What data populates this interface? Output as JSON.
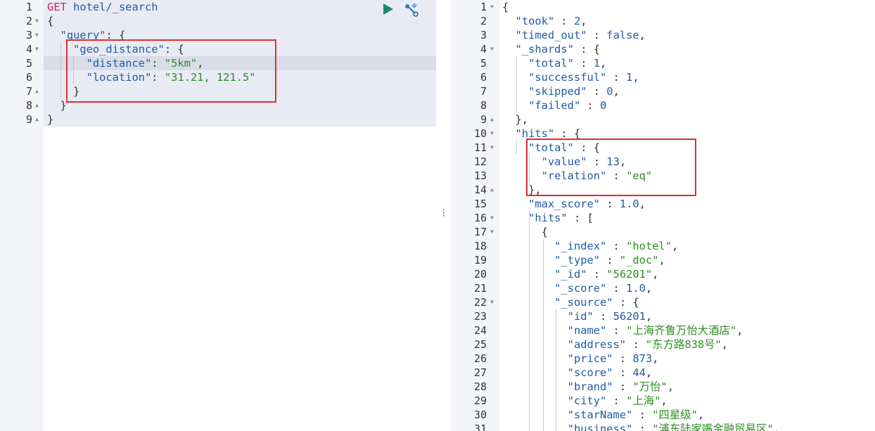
{
  "request": {
    "method": "GET",
    "path": "hotel/_search",
    "lines": [
      "1",
      "2",
      "3",
      "4",
      "5",
      "6",
      "7",
      "8",
      "9"
    ],
    "code": {
      "l2": "{",
      "l3_key": "\"query\"",
      "l3_rest": ": {",
      "l4_key": "\"geo_distance\"",
      "l4_rest": ": {",
      "l5_key": "\"distance\"",
      "l5_val": "\"5km\"",
      "l6_key": "\"location\"",
      "l6_val": "\"31.21, 121.5\"",
      "l7": "}",
      "l8": "}",
      "l9": "}"
    },
    "run_icon": "play-icon",
    "settings_icon": "wrench-icon"
  },
  "response": {
    "lines": [
      "1",
      "2",
      "3",
      "4",
      "5",
      "6",
      "7",
      "8",
      "9",
      "10",
      "11",
      "12",
      "13",
      "14",
      "15",
      "16",
      "17",
      "18",
      "19",
      "20",
      "21",
      "22",
      "23",
      "24",
      "25",
      "26",
      "27",
      "28",
      "29",
      "30",
      "31"
    ],
    "took": "2",
    "timed_out": "false",
    "shards_total": "1",
    "shards_successful": "1",
    "shards_skipped": "0",
    "shards_failed": "0",
    "hits_total_value": "13",
    "hits_total_relation": "\"eq\"",
    "max_score": "1.0",
    "index": "\"hotel\"",
    "type": "\"_doc\"",
    "id": "\"56201\"",
    "score": "1.0",
    "source_id": "56201",
    "name": "\"上海齐鲁万怡大酒店\"",
    "address": "\"东方路838号\"",
    "price": "873",
    "source_score": "44",
    "brand": "\"万怡\"",
    "city": "\"上海\"",
    "starName": "\"四星级\"",
    "business": "\"浦东陆家嘴金融贸易区\""
  },
  "colors": {
    "keyword": "#205ba6",
    "string": "#2e8d21",
    "method": "#c72768",
    "highlight": "#e12d2d"
  }
}
